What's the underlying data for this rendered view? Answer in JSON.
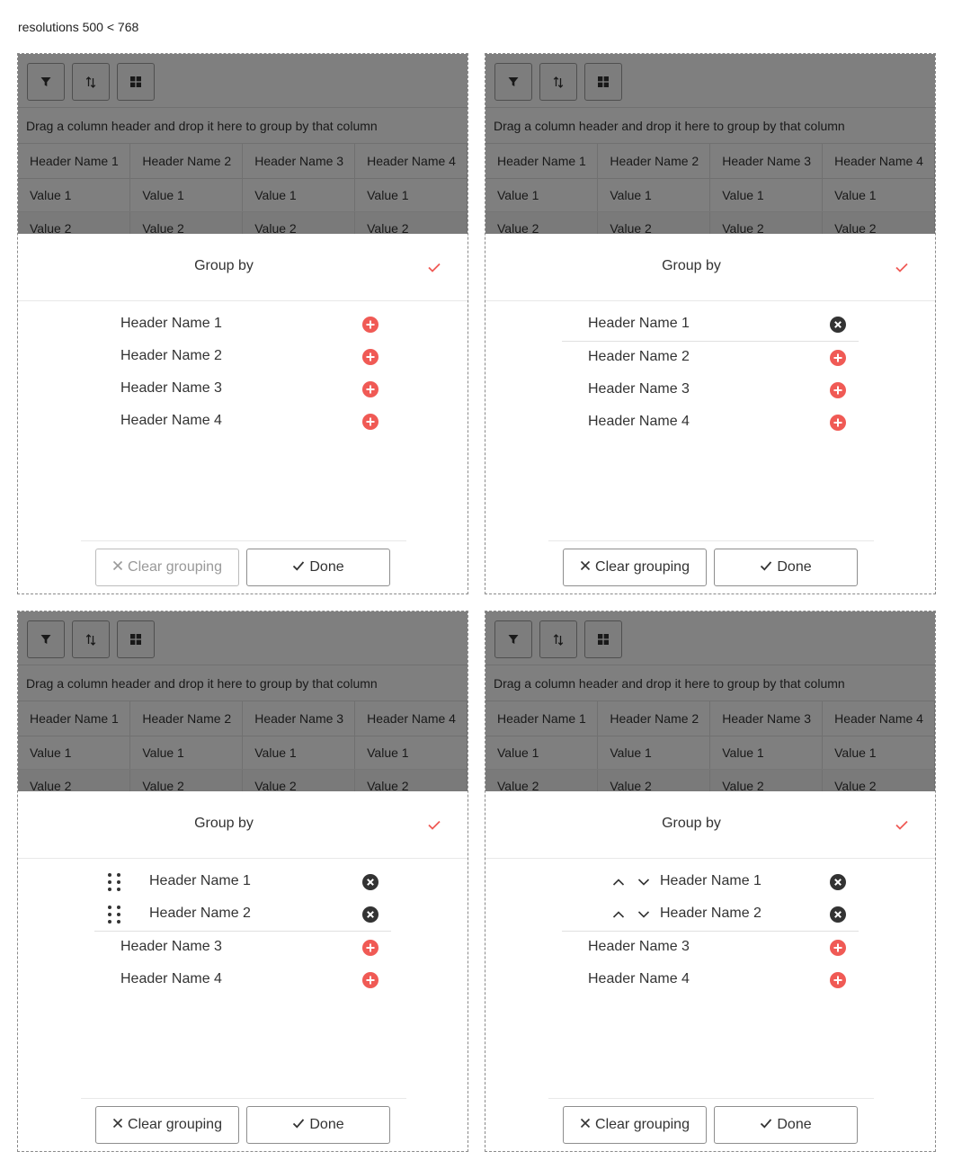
{
  "page": {
    "title": "resolutions 500 < 768"
  },
  "toolbar": {
    "buttons": [
      {
        "icon": "filter-icon"
      },
      {
        "icon": "sort-icon"
      },
      {
        "icon": "grid-icon"
      }
    ]
  },
  "grid": {
    "group_hint": "Drag a column header and drop it here to group by that column",
    "headers": [
      "Header Name 1",
      "Header Name 2",
      "Header Name 3",
      "Header Name 4"
    ],
    "rows": [
      [
        "Value 1",
        "Value 1",
        "Value 1",
        "Value 1"
      ],
      [
        "Value 2",
        "Value 2",
        "Value 2",
        "Value 2"
      ]
    ]
  },
  "popup": {
    "title": "Group by",
    "clear_label": "Clear grouping",
    "done_label": "Done",
    "columns": [
      "Header Name 1",
      "Header Name 2",
      "Header Name 3",
      "Header Name 4"
    ]
  },
  "colors": {
    "accent": "#f05a55",
    "remove": "#333333",
    "overlay": "rgba(0,0,0,0.5)"
  },
  "variants": [
    {
      "grouped_count": 0,
      "reorder_control": "none",
      "clear_enabled": false
    },
    {
      "grouped_count": 1,
      "reorder_control": "none",
      "clear_enabled": true
    },
    {
      "grouped_count": 2,
      "reorder_control": "drag-handle",
      "clear_enabled": true
    },
    {
      "grouped_count": 2,
      "reorder_control": "up-down-arrows",
      "clear_enabled": true
    }
  ]
}
